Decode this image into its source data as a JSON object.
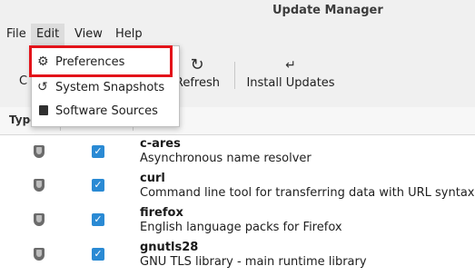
{
  "window": {
    "title": "Update Manager"
  },
  "menubar": {
    "file": "File",
    "edit": "Edit",
    "view": "View",
    "help": "Help"
  },
  "toolbar": {
    "clear_partial": "C",
    "refresh_label": "Refresh",
    "refresh_icon": "refresh-icon",
    "install_label": "Install Updates",
    "install_icon": "download-icon"
  },
  "edit_menu": {
    "items": [
      {
        "label": "Preferences",
        "icon": "gear-icon"
      },
      {
        "label": "System Snapshots",
        "icon": "history-icon"
      },
      {
        "label": "Software Sources",
        "icon": "package-icon"
      }
    ]
  },
  "list": {
    "header_type": "Type",
    "rows": [
      {
        "name": "c-ares",
        "description": "Asynchronous name resolver",
        "checked": true
      },
      {
        "name": "curl",
        "description": "Command line tool for transferring data with URL syntax",
        "checked": true
      },
      {
        "name": "firefox",
        "description": "English language packs for Firefox",
        "checked": true
      },
      {
        "name": "gnutls28",
        "description": "GNU TLS library - main runtime library",
        "checked": true
      }
    ]
  },
  "colors": {
    "checkbox": "#2a8ad4",
    "highlight": "#e3131a",
    "chrome": "#f0f0f0"
  }
}
